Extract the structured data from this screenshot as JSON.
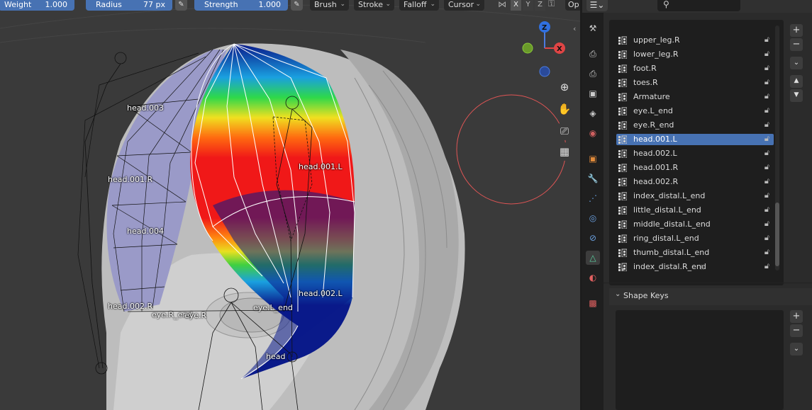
{
  "toolbar": {
    "weight": {
      "label": "Weight",
      "value": "1.000"
    },
    "radius": {
      "label": "Radius",
      "value": "77 px"
    },
    "strength": {
      "label": "Strength",
      "value": "1.000"
    },
    "menus": [
      "Brush",
      "Stroke",
      "Falloff",
      "Cursor"
    ],
    "axes": [
      "X",
      "Y",
      "Z"
    ],
    "options_truncated": "Op"
  },
  "gizmo": {
    "z_label": "Z",
    "x_label": "X"
  },
  "bones": [
    {
      "name": "head.003"
    },
    {
      "name": "head.001.R"
    },
    {
      "name": "head.004"
    },
    {
      "name": "head.002.R"
    },
    {
      "name": "eye.R_end"
    },
    {
      "name": "eye.R"
    },
    {
      "name": "eye.L_end"
    },
    {
      "name": "head.001.L"
    },
    {
      "name": "head.002.L"
    },
    {
      "name": "head"
    }
  ],
  "vertex_groups": [
    {
      "name": "upper_leg.R",
      "active": false
    },
    {
      "name": "lower_leg.R",
      "active": false
    },
    {
      "name": "foot.R",
      "active": false
    },
    {
      "name": "toes.R",
      "active": false
    },
    {
      "name": "Armature",
      "active": false
    },
    {
      "name": "eye.L_end",
      "active": false
    },
    {
      "name": "eye.R_end",
      "active": false
    },
    {
      "name": "head.001.L",
      "active": true
    },
    {
      "name": "head.002.L",
      "active": false
    },
    {
      "name": "head.001.R",
      "active": false
    },
    {
      "name": "head.002.R",
      "active": false
    },
    {
      "name": "index_distal.L_end",
      "active": false
    },
    {
      "name": "little_distal.L_end",
      "active": false
    },
    {
      "name": "middle_distal.L_end",
      "active": false
    },
    {
      "name": "ring_distal.L_end",
      "active": false
    },
    {
      "name": "thumb_distal.L_end",
      "active": false
    },
    {
      "name": "index_distal.R_end",
      "active": false
    }
  ],
  "shape_keys": {
    "title": "Shape Keys"
  },
  "colors": {
    "accent": "#4772b3",
    "brush_circle": "#e05555"
  }
}
